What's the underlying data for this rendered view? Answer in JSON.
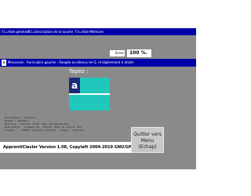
{
  "menu": {
    "items": [
      {
        "label": "F1=Aide générale"
      },
      {
        "label": "F2=Description de la touche"
      },
      {
        "label": "F3=Aide-Mémoire"
      }
    ]
  },
  "score": {
    "label": "Score",
    "value": "100 %."
  },
  "instruction": {
    "prefix": "a",
    "text": "Minuscule : Auriculaire gauche : Rangée au-dessus de Q, et légèrement à droite"
  },
  "prompt": {
    "label": "Tapez :"
  },
  "key": {
    "letter": "a"
  },
  "info": {
    "lines": [
      "Utilisateur : Apprenti",
      "Niveau : Standard",
      "Exercice : Touches 'Aide' dans les majuscules",
      "Description : Frappez sur 'Entrée' dans le clavier des",
      "touches   : AZERTY français standard   Langue : Français"
    ]
  },
  "footer": {
    "version": "ApprentiClavier Version 1.08,   Copyleft 2004-2010 GNU/GPL"
  },
  "quit_button": {
    "line1": "Quitter vers",
    "line2": "Menu",
    "line3": "(Echap)"
  },
  "colors": {
    "background": "#8a8a8a",
    "menu_bar": "#0000a8",
    "key_row": "#1fc8bb",
    "key_letter_bg": "#1b2a78",
    "quit_button": "#c8c8c8"
  }
}
